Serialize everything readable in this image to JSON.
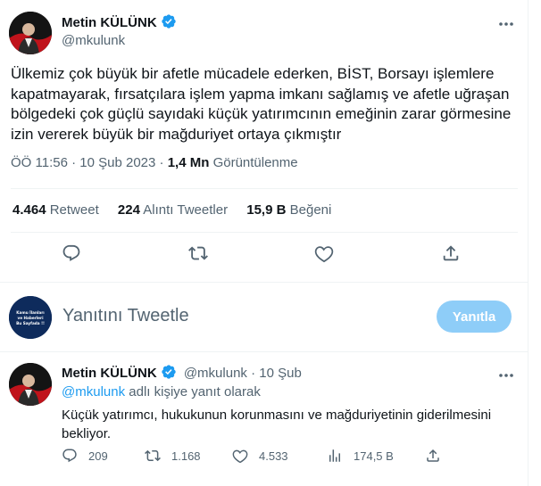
{
  "tweet": {
    "author": {
      "name": "Metin KÜLÜNK",
      "handle": "@mkulunk",
      "verified": true
    },
    "text": "Ülkemiz çok büyük bir afetle mücadele ederken, BİST, Borsayı işlemlere kapatmayarak, fırsatçılara işlem yapma imkanı sağlamış ve afetle uğraşan bölgedeki çok güçlü sayıdaki küçük yatırımcının emeğinin zarar görmesine izin vererek  büyük bir mağduriyet ortaya çıkmıştır",
    "time": "ÖÖ 11:56",
    "dot": "·",
    "date": "10 Şub 2023",
    "views": "1,4 Mn",
    "views_label": "Görüntülenme",
    "stats": {
      "retweets": "4.464",
      "retweets_label": "Retweet",
      "quotes": "224",
      "quotes_label": "Alıntı Tweetler",
      "likes": "15,9 B",
      "likes_label": "Beğeni"
    },
    "actions": [
      "reply-icon",
      "retweet-icon",
      "like-icon",
      "share-icon"
    ]
  },
  "reply_box": {
    "placeholder": "Yanıtını Tweetle",
    "button_label": "Yanıtla",
    "avatar_text": "Kamu İlanları ve Haberleri Bu Sayfada !!",
    "button_color": "#8ecdf8"
  },
  "reply": {
    "author": {
      "name": "Metin KÜLÜNK",
      "handle": "@mkulunk",
      "verified": true
    },
    "dot": "·",
    "date": "10 Şub",
    "replying_to_handle": "@mkulunk",
    "replying_to_suffix": "adlı kişiye yanıt olarak",
    "text": "Küçük yatırımcı, hukukunun korunmasını ve mağduriyetinin giderilmesini bekliyor.",
    "counts": {
      "replies": "209",
      "retweets": "1.168",
      "likes": "4.533",
      "views": "174,5 B"
    }
  },
  "colors": {
    "accent": "#1d9bf0",
    "muted": "#536471",
    "text": "#0f1419",
    "border": "#eff3f4"
  }
}
